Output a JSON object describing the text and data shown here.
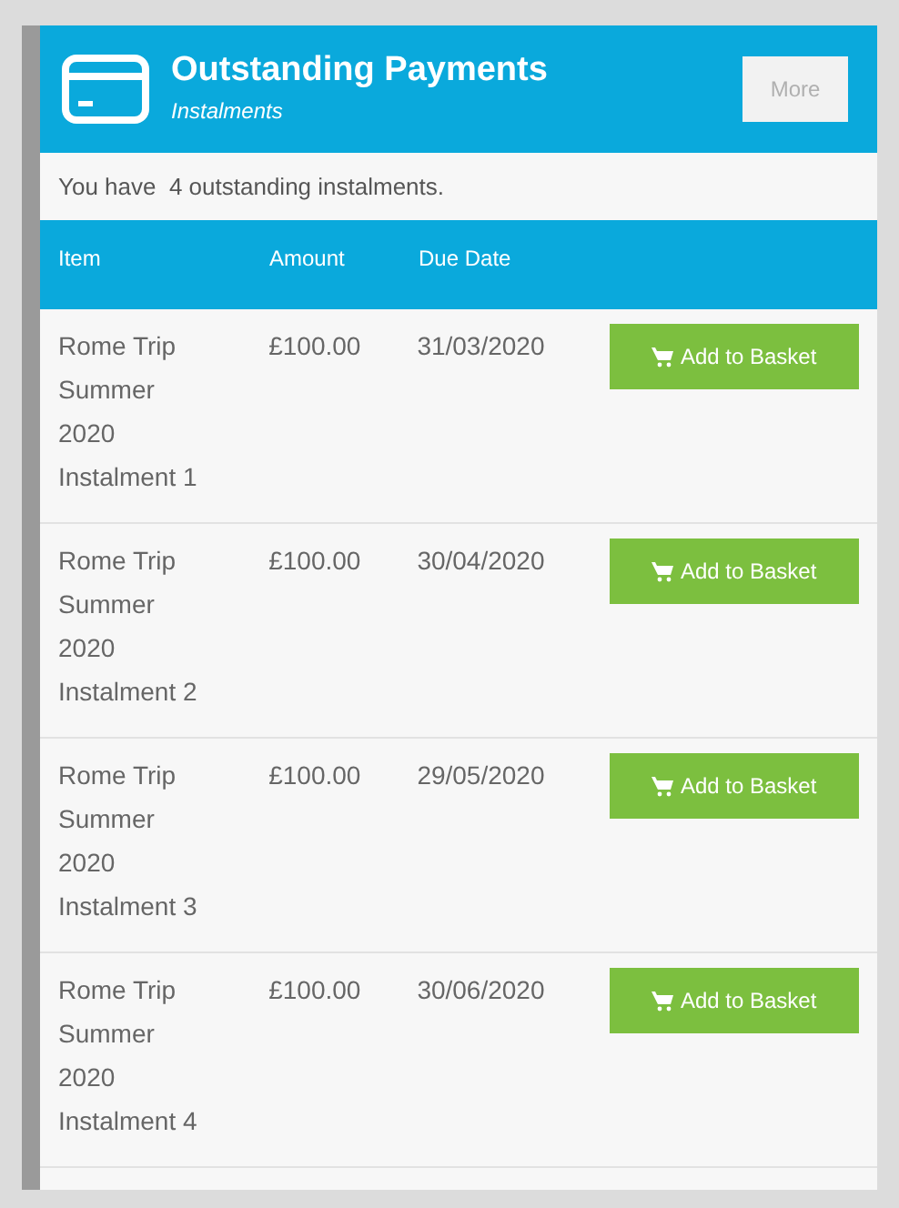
{
  "header": {
    "title": "Outstanding Payments",
    "subtitle": "Instalments",
    "more_button": "More"
  },
  "summary": "You have  4 outstanding instalments.",
  "table": {
    "columns": [
      "Item",
      "Amount",
      "Due Date"
    ],
    "rows": [
      {
        "item": "Rome Trip Summer 2020 Instalment 1",
        "amount": "£100.00",
        "due_date": "31/03/2020",
        "action": "Add to Basket"
      },
      {
        "item": "Rome Trip Summer 2020 Instalment 2",
        "amount": "£100.00",
        "due_date": "30/04/2020",
        "action": "Add to Basket"
      },
      {
        "item": "Rome Trip Summer 2020 Instalment 3",
        "amount": "£100.00",
        "due_date": "29/05/2020",
        "action": "Add to Basket"
      },
      {
        "item": "Rome Trip Summer 2020 Instalment 4",
        "amount": "£100.00",
        "due_date": "30/06/2020",
        "action": "Add to Basket"
      }
    ]
  }
}
